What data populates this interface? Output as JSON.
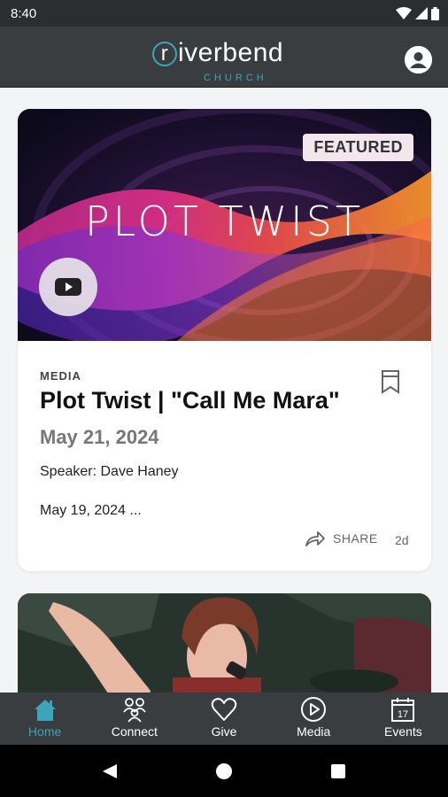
{
  "status": {
    "time": "8:40"
  },
  "header": {
    "logo_word": "iverbend",
    "logo_letter": "r",
    "logo_sub": "CHURCH"
  },
  "feed": {
    "card": {
      "badge": "FEATURED",
      "hero_title": "PLOT TWIST",
      "category": "MEDIA",
      "title": "Plot Twist | \"Call Me Mara\"",
      "date": "May 21, 2024",
      "speaker": "Speaker: Dave Haney",
      "excerpt": "May 19, 2024 ...",
      "share_label": "SHARE",
      "age": "2d"
    }
  },
  "tabs": [
    {
      "label": "Home",
      "icon": "home-icon",
      "active": true
    },
    {
      "label": "Connect",
      "icon": "people-icon",
      "active": false
    },
    {
      "label": "Give",
      "icon": "heart-icon",
      "active": false
    },
    {
      "label": "Media",
      "icon": "play-circle-icon",
      "active": false
    },
    {
      "label": "Events",
      "icon": "calendar-icon",
      "active": false,
      "badge_text": "17"
    }
  ],
  "colors": {
    "accent": "#3aa6b8",
    "bar": "#3a3d40"
  }
}
